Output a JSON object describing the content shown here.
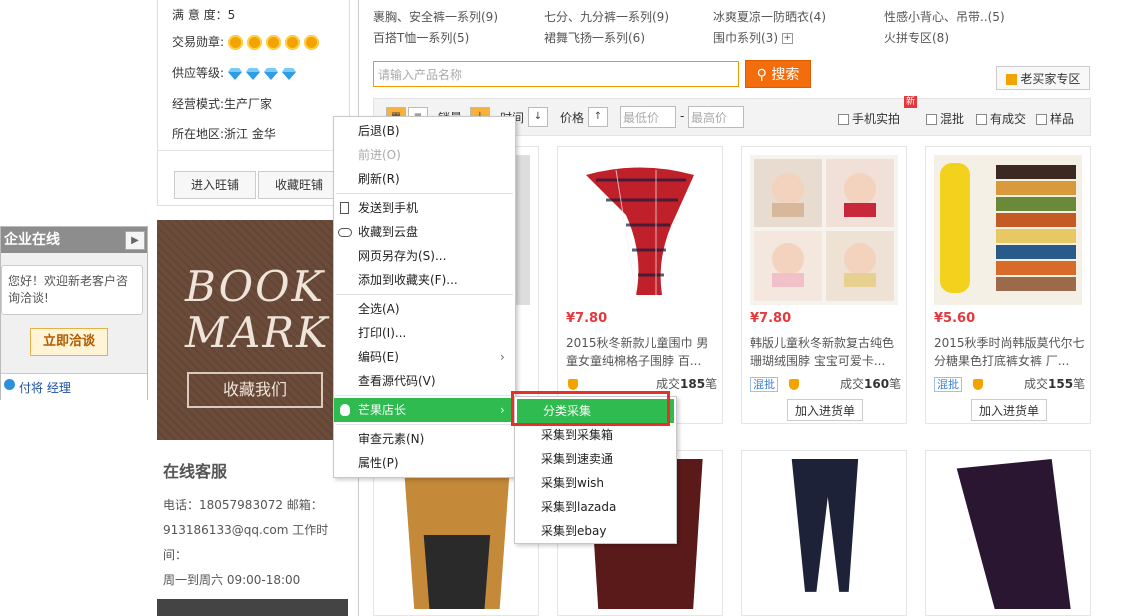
{
  "shop_info": {
    "satisfaction": "满 意 度：5",
    "trade_medal_label": "交易勋章:",
    "supply_level_label": "供应等级:",
    "business_mode": "经营模式:生产厂家",
    "location": "所在地区:浙江 金华",
    "enter_wangpu": "进入旺铺",
    "collect_wangpu": "收藏旺铺"
  },
  "online": {
    "title": "企业在线",
    "greeting": "您好！欢迎新老客户咨询洽谈!",
    "talk_button": "立即洽谈",
    "contact": "付将 经理"
  },
  "bookmark": {
    "line1": "BOOK",
    "line2": "MARK",
    "button": "收藏我们"
  },
  "customer_service": {
    "title": "在线客服",
    "line1": "电话：18057983072 邮箱：",
    "line2": "913186133@qq.com 工作时",
    "line3": "间：",
    "line4": "周一到周六 09:00-18:00"
  },
  "categories": [
    "裹胸、安全裤一系列(9)",
    "七分、九分裤一系列(9)",
    "冰爽夏凉一防晒衣(4)",
    "性感小背心、吊带..(5)",
    "百搭T恤一系列(5)",
    "裙舞飞扬一系列(6)",
    "围巾系列(3)",
    "火拼专区(8)"
  ],
  "search": {
    "placeholder": "请输入产品名称",
    "button": "搜索",
    "buyer_zone": "老买家专区"
  },
  "filters": {
    "sales": "销量",
    "time": "时间",
    "price": "价格",
    "min_price": "最低价",
    "dash": "-",
    "max_price": "最高价",
    "mobile_photo": "手机实拍",
    "new_badge": "新",
    "mixed": "混批",
    "has_deal": "有成交",
    "sample": "样品"
  },
  "products": [
    {
      "price": "¥7.80",
      "title1": "2015秋冬新款儿童围巾 男",
      "title2": "童女童纯棉格子围脖 百...",
      "sold_prefix": "成交",
      "sold_count": "185",
      "sold_unit": "笔",
      "mixed": "",
      "add": "加入进货单"
    },
    {
      "price": "¥7.80",
      "title1": "韩版儿童秋冬新款复古纯色",
      "title2": "珊瑚绒围脖 宝宝可爱卡...",
      "sold_prefix": "成交",
      "sold_count": "160",
      "sold_unit": "笔",
      "mixed": "混批",
      "add": "加入进货单"
    },
    {
      "price": "¥5.60",
      "title1": "2015秋季时尚韩版莫代尔七",
      "title2": "分糖果色打底裤女裤 厂...",
      "sold_prefix": "成交",
      "sold_count": "155",
      "sold_unit": "笔",
      "mixed": "混批",
      "add": "加入进货单"
    }
  ],
  "context_menu": {
    "back": "后退(B)",
    "forward": "前进(O)",
    "refresh": "刷新(R)",
    "send_to_phone": "发送到手机",
    "save_to_cloud": "收藏到云盘",
    "save_as": "网页另存为(S)...",
    "add_favorite": "添加到收藏夹(F)...",
    "select_all": "全选(A)",
    "print": "打印(I)...",
    "encoding": "编码(E)",
    "view_source": "查看源代码(V)",
    "mango": "芒果店长",
    "inspect": "审查元素(N)",
    "properties": "属性(P)"
  },
  "submenu": {
    "category_collect": "分类采集",
    "to_box": "采集到采集箱",
    "to_smt": "采集到速卖通",
    "to_wish": "采集到wish",
    "to_lazada": "采集到lazada",
    "to_ebay": "采集到ebay"
  }
}
